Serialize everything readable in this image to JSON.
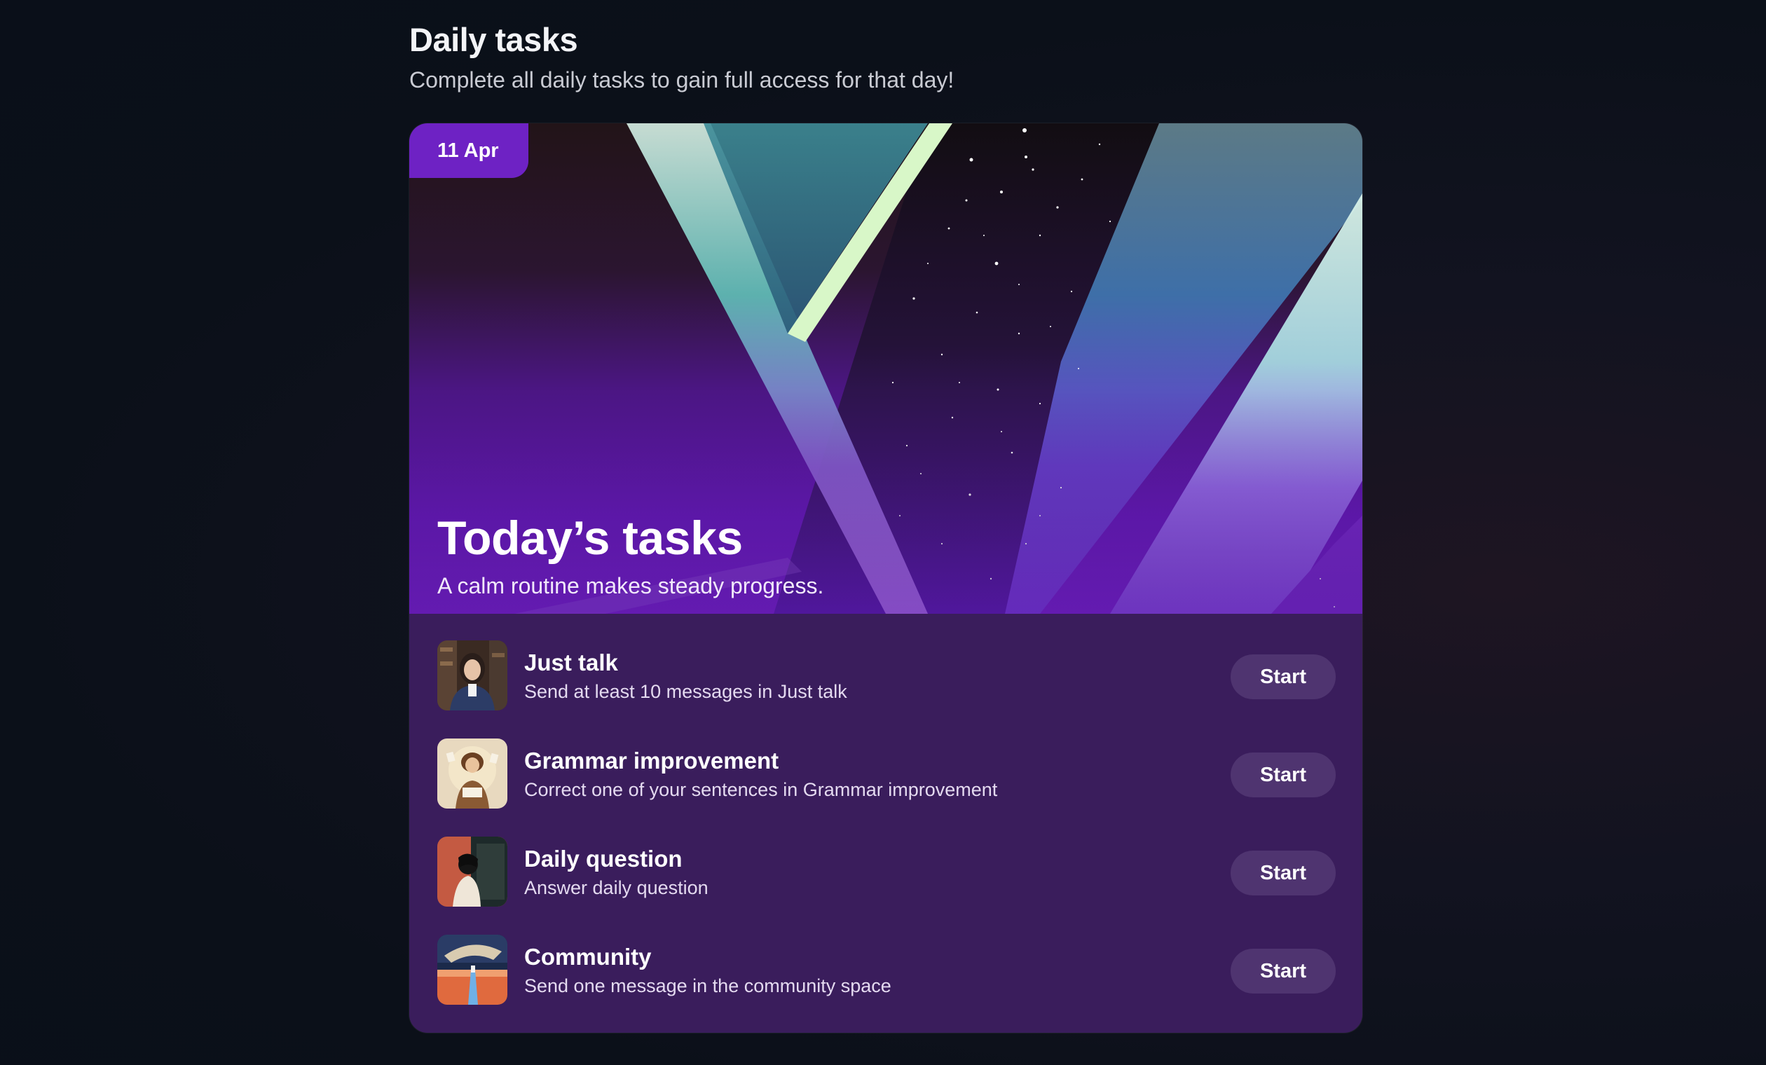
{
  "header": {
    "title": "Daily tasks",
    "subtitle": "Complete all daily tasks to gain full access for that day!"
  },
  "hero": {
    "date_badge": "11 Apr",
    "title": "Today’s tasks",
    "subtitle": "A calm routine makes steady progress."
  },
  "tasks": [
    {
      "name": "Just talk",
      "description": "Send at least 10 messages in Just talk",
      "button": "Start",
      "thumbnail": "portrait-woman-thumbnail"
    },
    {
      "name": "Grammar improvement",
      "description": "Correct one of your sentences in Grammar improvement",
      "button": "Start",
      "thumbnail": "illustrated-reader-thumbnail"
    },
    {
      "name": "Daily question",
      "description": "Answer daily question",
      "button": "Start",
      "thumbnail": "silhouette-painting-thumbnail"
    },
    {
      "name": "Community",
      "description": "Send one message in the community space",
      "button": "Start",
      "thumbnail": "surreal-landscape-thumbnail"
    }
  ],
  "colors": {
    "page_background": "#0b1019",
    "card_background": "#3a1d5c",
    "badge_background": "#6e22c4",
    "button_background": "#4f3470",
    "accent_purple": "#7b1fd0"
  }
}
